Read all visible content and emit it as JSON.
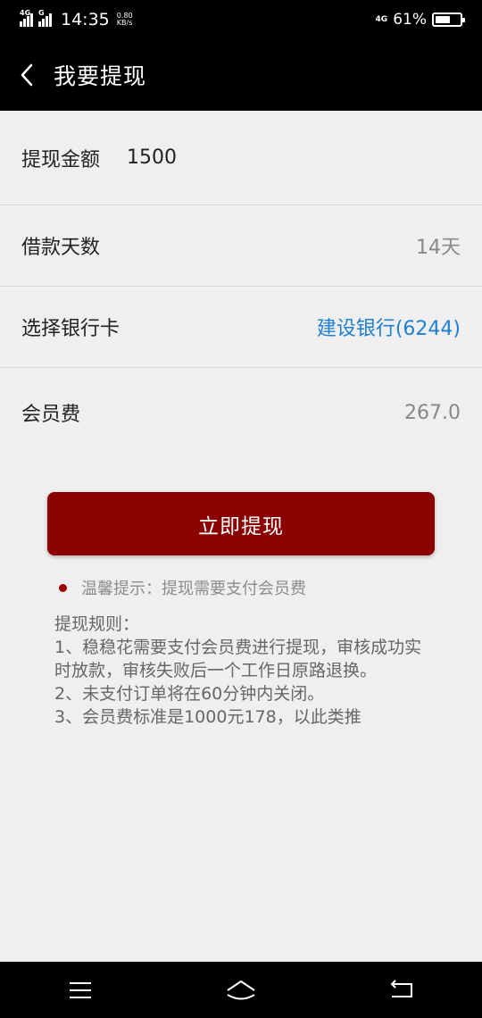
{
  "status_bar": {
    "network_left": "4G",
    "network_left2": "G",
    "time": "14:35",
    "speed_value": "0.80",
    "speed_unit": "KB/s",
    "network_right": "4G",
    "battery_percent": "61%",
    "battery_level": 0.61
  },
  "nav": {
    "back_icon": "chevron-left-icon",
    "title": "我要提现"
  },
  "form": {
    "amount_label": "提现金额",
    "amount_value": "1500",
    "days_label": "借款天数",
    "days_value": "14天",
    "bank_label": "选择银行卡",
    "bank_value": "建设银行(6244)",
    "fee_label": "会员费",
    "fee_value": "267.0"
  },
  "actions": {
    "withdraw_label": "立即提现"
  },
  "tip": {
    "text": "温馨提示：提现需要支付会员费"
  },
  "rules": {
    "title": "提现规则：",
    "items": [
      "1、稳稳花需要支付会员费进行提现，审核成功实时放款，审核失败后一个工作日原路退换。",
      "2、未支付订单将在60分钟内关闭。",
      "3、会员费标准是1000元178，以此类推"
    ]
  },
  "system_nav": {
    "menu_icon": "menu-icon",
    "home_icon": "home-icon",
    "back_icon": "back-arrow-icon"
  },
  "colors": {
    "primary": "#8b0000",
    "link": "#1f7fd0",
    "background": "#efefef"
  }
}
